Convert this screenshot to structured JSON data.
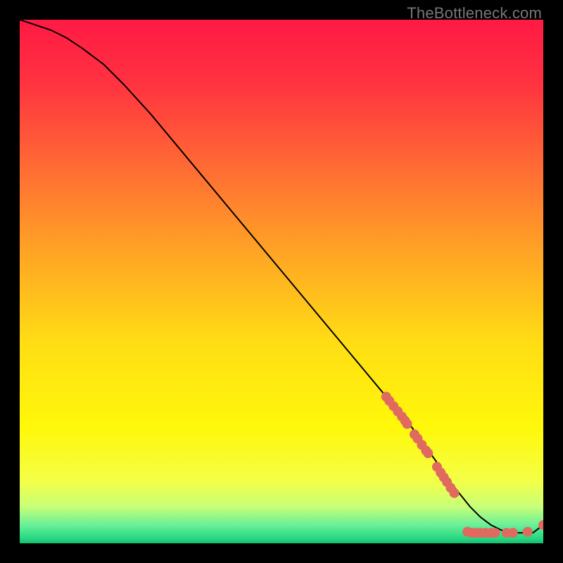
{
  "attribution": "TheBottleneck.com",
  "chart_data": {
    "type": "line",
    "title": "",
    "xlabel": "",
    "ylabel": "",
    "xlim": [
      0,
      100
    ],
    "ylim": [
      0,
      100
    ],
    "grid": false,
    "legend": false,
    "background_gradient": {
      "stops": [
        {
          "offset": 0.0,
          "color": "#ff1a44"
        },
        {
          "offset": 0.12,
          "color": "#ff3240"
        },
        {
          "offset": 0.28,
          "color": "#ff6a34"
        },
        {
          "offset": 0.45,
          "color": "#ffa624"
        },
        {
          "offset": 0.62,
          "color": "#ffde14"
        },
        {
          "offset": 0.78,
          "color": "#fff80a"
        },
        {
          "offset": 0.88,
          "color": "#f4ff46"
        },
        {
          "offset": 0.93,
          "color": "#c8ff78"
        },
        {
          "offset": 0.965,
          "color": "#6af098"
        },
        {
          "offset": 0.99,
          "color": "#28d882"
        },
        {
          "offset": 1.0,
          "color": "#12c070"
        }
      ]
    },
    "series": [
      {
        "name": "bottleneck-curve",
        "color": "#000000",
        "x": [
          0,
          3,
          6,
          9,
          12,
          16,
          20,
          25,
          30,
          35,
          40,
          45,
          50,
          55,
          60,
          65,
          70,
          75,
          80,
          82,
          84,
          86,
          88,
          90,
          92,
          94,
          96,
          98,
          100
        ],
        "y": [
          100,
          99,
          98,
          96.5,
          94.5,
          91.5,
          87.5,
          82,
          76,
          70,
          64,
          58,
          52,
          46,
          40,
          34,
          28,
          22,
          15,
          12,
          9.5,
          7,
          5,
          3.5,
          2.5,
          2,
          2,
          2,
          3.5
        ]
      }
    ],
    "scatter": [
      {
        "name": "datapoints",
        "color": "#e06a60",
        "radius": 7,
        "points": [
          {
            "x": 70.0,
            "y": 28.0
          },
          {
            "x": 70.6,
            "y": 27.2
          },
          {
            "x": 71.4,
            "y": 26.2
          },
          {
            "x": 72.2,
            "y": 25.2
          },
          {
            "x": 73.0,
            "y": 24.2
          },
          {
            "x": 73.6,
            "y": 23.4
          },
          {
            "x": 74.0,
            "y": 22.8
          },
          {
            "x": 75.4,
            "y": 20.8
          },
          {
            "x": 76.0,
            "y": 20.0
          },
          {
            "x": 76.8,
            "y": 18.8
          },
          {
            "x": 77.6,
            "y": 17.7
          },
          {
            "x": 78.0,
            "y": 17.2
          },
          {
            "x": 79.7,
            "y": 14.6
          },
          {
            "x": 80.4,
            "y": 13.5
          },
          {
            "x": 81.0,
            "y": 12.6
          },
          {
            "x": 81.6,
            "y": 11.7
          },
          {
            "x": 82.3,
            "y": 10.6
          },
          {
            "x": 83.0,
            "y": 9.6
          },
          {
            "x": 85.5,
            "y": 2.2
          },
          {
            "x": 86.3,
            "y": 2.0
          },
          {
            "x": 87.2,
            "y": 2.0
          },
          {
            "x": 88.0,
            "y": 2.0
          },
          {
            "x": 89.0,
            "y": 2.0
          },
          {
            "x": 90.0,
            "y": 2.0
          },
          {
            "x": 90.8,
            "y": 2.0
          },
          {
            "x": 93.0,
            "y": 2.0
          },
          {
            "x": 94.2,
            "y": 2.0
          },
          {
            "x": 97.0,
            "y": 2.2
          },
          {
            "x": 100.0,
            "y": 3.5
          }
        ]
      }
    ]
  }
}
